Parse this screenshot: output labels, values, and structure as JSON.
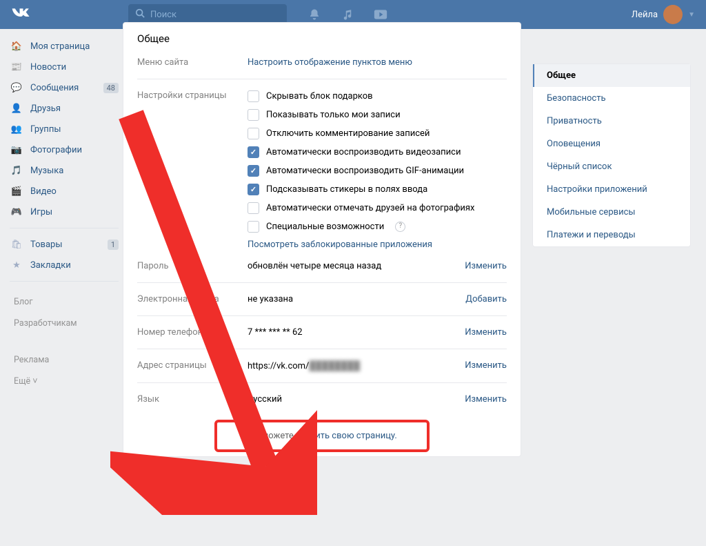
{
  "header": {
    "search_placeholder": "Поиск",
    "username": "Лейла"
  },
  "nav": {
    "items": [
      {
        "label": "Моя страница",
        "icon": "home"
      },
      {
        "label": "Новости",
        "icon": "news"
      },
      {
        "label": "Сообщения",
        "icon": "msg",
        "badge": "48"
      },
      {
        "label": "Друзья",
        "icon": "friends"
      },
      {
        "label": "Группы",
        "icon": "groups"
      },
      {
        "label": "Фотографии",
        "icon": "photos"
      },
      {
        "label": "Музыка",
        "icon": "music"
      },
      {
        "label": "Видео",
        "icon": "video"
      },
      {
        "label": "Игры",
        "icon": "games"
      }
    ],
    "extra": [
      {
        "label": "Товары",
        "icon": "market",
        "badge": "1"
      },
      {
        "label": "Закладки",
        "icon": "bookmark"
      }
    ],
    "footer": [
      "Блог",
      "Разработчикам",
      "Реклама",
      "Ещё ˅"
    ]
  },
  "settings": {
    "title": "Общее",
    "menu_label": "Меню сайта",
    "menu_link": "Настроить отображение пунктов меню",
    "page_label": "Настройки страницы",
    "checks": [
      {
        "label": "Скрывать блок подарков",
        "checked": false
      },
      {
        "label": "Показывать только мои записи",
        "checked": false
      },
      {
        "label": "Отключить комментирование записей",
        "checked": false
      },
      {
        "label": "Автоматически воспроизводить видеозаписи",
        "checked": true
      },
      {
        "label": "Автоматически воспроизводить GIF-анимации",
        "checked": true
      },
      {
        "label": "Подсказывать стикеры в полях ввода",
        "checked": true
      },
      {
        "label": "Автоматически отмечать друзей на фотографиях",
        "checked": false
      },
      {
        "label": "Специальные возможности",
        "checked": false,
        "help": true
      }
    ],
    "blocked_apps": "Посмотреть заблокированные приложения",
    "rows": [
      {
        "label": "Пароль",
        "value": "обновлён четыре месяца назад",
        "action": "Изменить"
      },
      {
        "label": "Электронная почта",
        "value": "не указана",
        "action": "Добавить"
      },
      {
        "label": "Номер телефона",
        "value": "7 *** *** ** 62",
        "action": "Изменить"
      },
      {
        "label": "Адрес страницы",
        "value": "https://vk.com/",
        "action": "Изменить",
        "blur": true
      },
      {
        "label": "Язык",
        "value": "Русский",
        "action": "Изменить"
      }
    ],
    "delete_prefix": "Вы можете ",
    "delete_link": "удалить свою страницу."
  },
  "tabs": [
    "Общее",
    "Безопасность",
    "Приватность",
    "Оповещения",
    "Чёрный список",
    "Настройки приложений",
    "Мобильные сервисы",
    "Платежи и переводы"
  ]
}
